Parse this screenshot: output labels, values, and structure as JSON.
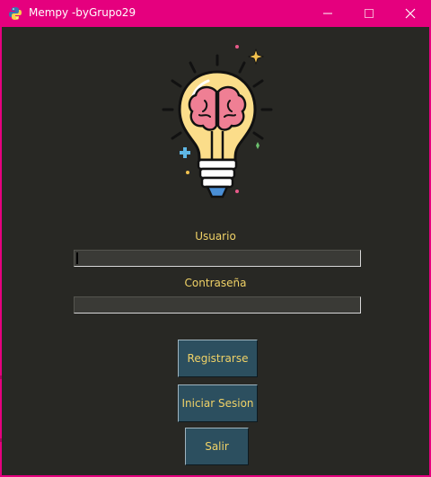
{
  "window": {
    "title": "Mempy -byGrupo29",
    "icon": "python-logo-icon",
    "controls": [
      "minimize-icon",
      "maximize-icon",
      "close-icon"
    ]
  },
  "logo": {
    "icon": "lightbulb-brain-icon"
  },
  "form": {
    "username_label": "Usuario",
    "username_value": "",
    "password_label": "Contraseña",
    "password_value": ""
  },
  "buttons": {
    "register": "Registrarse",
    "login": "Iniciar Sesion",
    "exit": "Salir"
  },
  "colors": {
    "titlebar": "#e5007e",
    "background": "#282824",
    "text": "#f0d267",
    "button": "#2c4f5f"
  }
}
